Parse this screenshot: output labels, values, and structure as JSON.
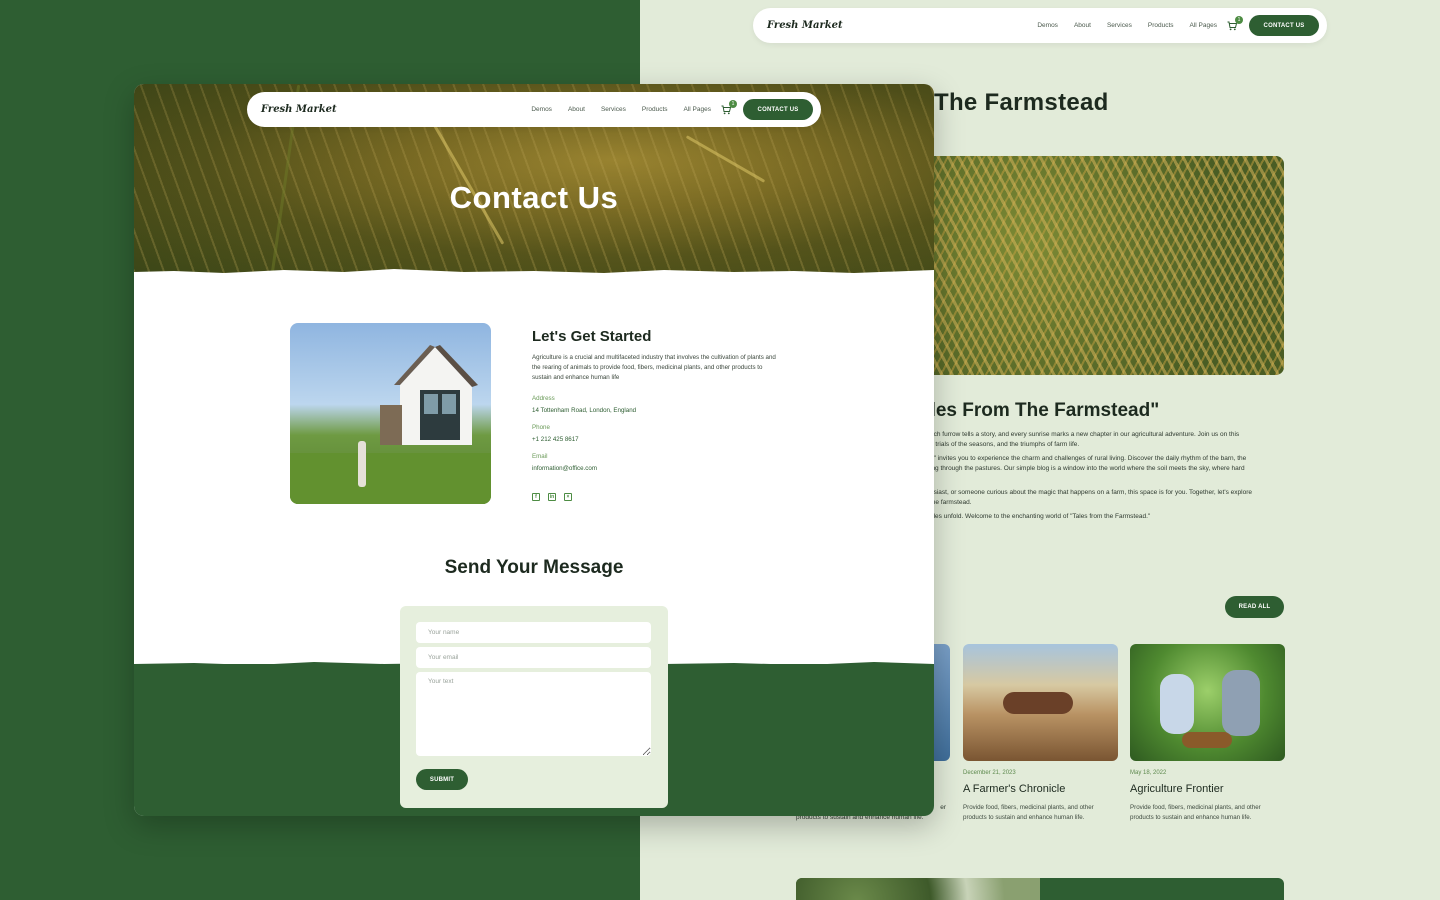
{
  "colors": {
    "brand_green": "#2e5e32",
    "accent_green": "#4d8c43",
    "pale_green": "#e2ebd9",
    "form_bg": "#e6efdd"
  },
  "nav": {
    "logo": "Fresh Market",
    "links": [
      "Demos",
      "About",
      "Services",
      "Products",
      "All Pages"
    ],
    "cart_icon": "cart-icon",
    "cart_count": "1",
    "contact_button": "CONTACT US"
  },
  "front": {
    "hero_title": "Contact Us",
    "info": {
      "title": "Let's Get Started",
      "description": "Agriculture is a crucial and multifaceted industry that involves the cultivation of plants and the rearing of animals to provide food, fibers, medicinal plants, and other products to sustain and enhance human life",
      "address_label": "Address",
      "address": "14 Tottenham Road, London, England",
      "phone_label": "Phone",
      "phone": "+1 212 425 8617",
      "email_label": "Email",
      "email": "information@office.com",
      "social_icons": [
        "facebook-icon",
        "linkedin-icon",
        "x-icon"
      ]
    },
    "form": {
      "title": "Send Your Message",
      "name_placeholder": "Your name",
      "email_placeholder": "Your email",
      "text_placeholder": "Your text",
      "submit_label": "SUBMIT"
    }
  },
  "back": {
    "title_fragment": "The Farmstead",
    "article_title_fragment": "ales From The Farmstead\"",
    "para1_line1": "ach furrow tells a story, and every sunrise marks a new chapter in our agricultural adventure. Join us on this",
    "para1_line2": "e trials of the seasons, and the triumphs of farm life.",
    "para2_line1": "d\" invites you to experience the charm and challenges of rural living. Discover the daily rhythm of the barn, the",
    "para2_line2": "ing through the pastures. Our simple blog is a window into the world where the soil meets the sky, where hard",
    "para3_line1": "usiast, or someone curious about the magic that happens on a farm, this space is for you. Together, let's explore",
    "para3_line2": "the farmstead.",
    "para4_line1": "ales unfold. Welcome to the enchanting world of \"Tales from the Farmstead.\"",
    "read_all": "READ ALL",
    "partial_desc_line1": "er",
    "partial_desc_line2": "products to sustain and enhance human life.",
    "cards": [
      {
        "date": "December 21, 2023",
        "title": "A Farmer's Chronicle",
        "desc": "Provide food, fibers, medicinal plants, and other products to sustain and enhance human life."
      },
      {
        "date": "May 18, 2022",
        "title": "Agriculture Frontier",
        "desc": "Provide food, fibers, medicinal plants, and other products to sustain and enhance human life."
      }
    ]
  }
}
